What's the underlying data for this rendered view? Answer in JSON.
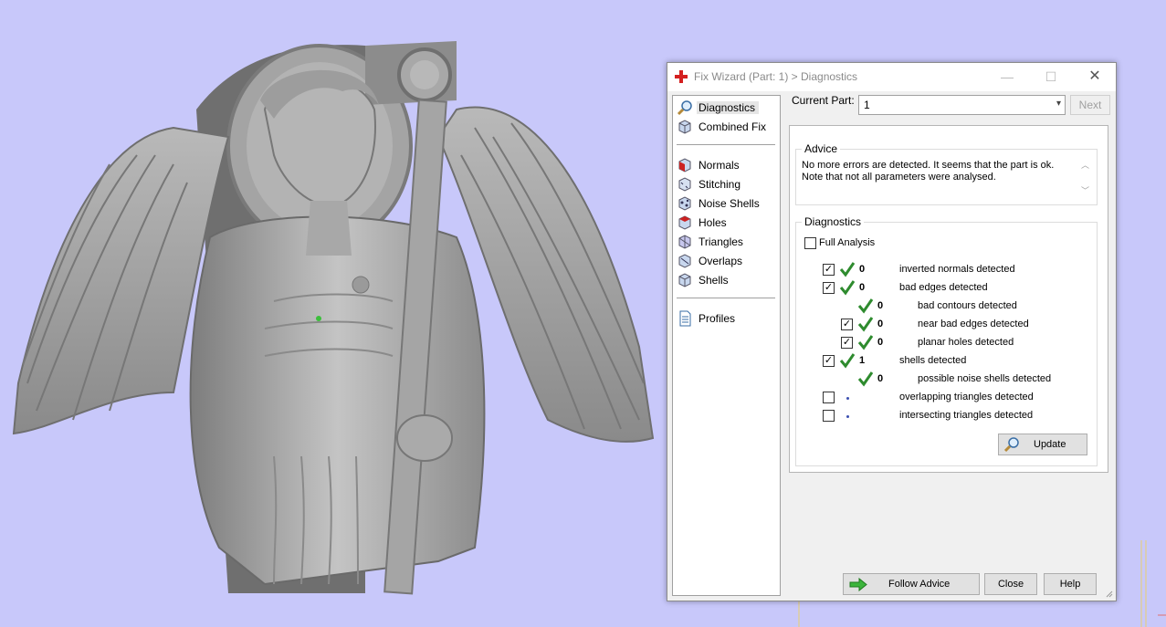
{
  "dialog": {
    "title": "Fix Wizard (Part: 1) > Diagnostics",
    "controls": {
      "minimize": "—",
      "maximize": "☐",
      "close": "✕"
    }
  },
  "sidebar": {
    "items": [
      {
        "label": "Diagnostics",
        "icon": "magnifier-icon",
        "selected": true
      },
      {
        "label": "Combined Fix",
        "icon": "cube-icon"
      },
      {
        "label": "Normals",
        "icon": "normals-cube-icon"
      },
      {
        "label": "Stitching",
        "icon": "stitching-cube-icon"
      },
      {
        "label": "Noise Shells",
        "icon": "noise-shells-icon"
      },
      {
        "label": "Holes",
        "icon": "holes-cube-icon"
      },
      {
        "label": "Triangles",
        "icon": "triangles-cube-icon"
      },
      {
        "label": "Overlaps",
        "icon": "overlaps-cube-icon"
      },
      {
        "label": "Shells",
        "icon": "shells-cube-icon"
      },
      {
        "label": "Profiles",
        "icon": "document-icon"
      }
    ]
  },
  "current_part": {
    "label": "Current Part:",
    "value": "1",
    "next_label": "Next"
  },
  "advice": {
    "title": "Advice",
    "line1": "No more errors are detected. It seems that the part is ok.",
    "line2": "Note that not all parameters were analysed."
  },
  "diagnostics": {
    "title": "Diagnostics",
    "full_analysis_label": "Full Analysis",
    "rows": [
      {
        "checked": true,
        "status": "ok",
        "count": "0",
        "label": "inverted normals detected"
      },
      {
        "checked": true,
        "status": "ok",
        "count": "0",
        "label": "bad edges detected"
      },
      {
        "checked": null,
        "status": "ok",
        "count": "0",
        "label": "bad contours detected"
      },
      {
        "checked": true,
        "status": "ok",
        "count": "0",
        "label": "near bad edges detected"
      },
      {
        "checked": true,
        "status": "ok",
        "count": "0",
        "label": "planar holes detected"
      },
      {
        "checked": true,
        "status": "ok",
        "count": "1",
        "label": "shells detected"
      },
      {
        "checked": null,
        "status": "ok",
        "count": "0",
        "label": "possible noise shells detected"
      },
      {
        "checked": false,
        "status": "none",
        "count": "",
        "label": "overlapping triangles detected"
      },
      {
        "checked": false,
        "status": "none",
        "count": "",
        "label": "intersecting triangles detected"
      }
    ],
    "update_label": "Update"
  },
  "footer": {
    "follow_advice_label": "Follow Advice",
    "close_label": "Close",
    "help_label": "Help"
  },
  "colors": {
    "viewport_background": "#c8c8fa",
    "model_gray": "#a9a9a9",
    "check_green": "#2e8b2e"
  }
}
